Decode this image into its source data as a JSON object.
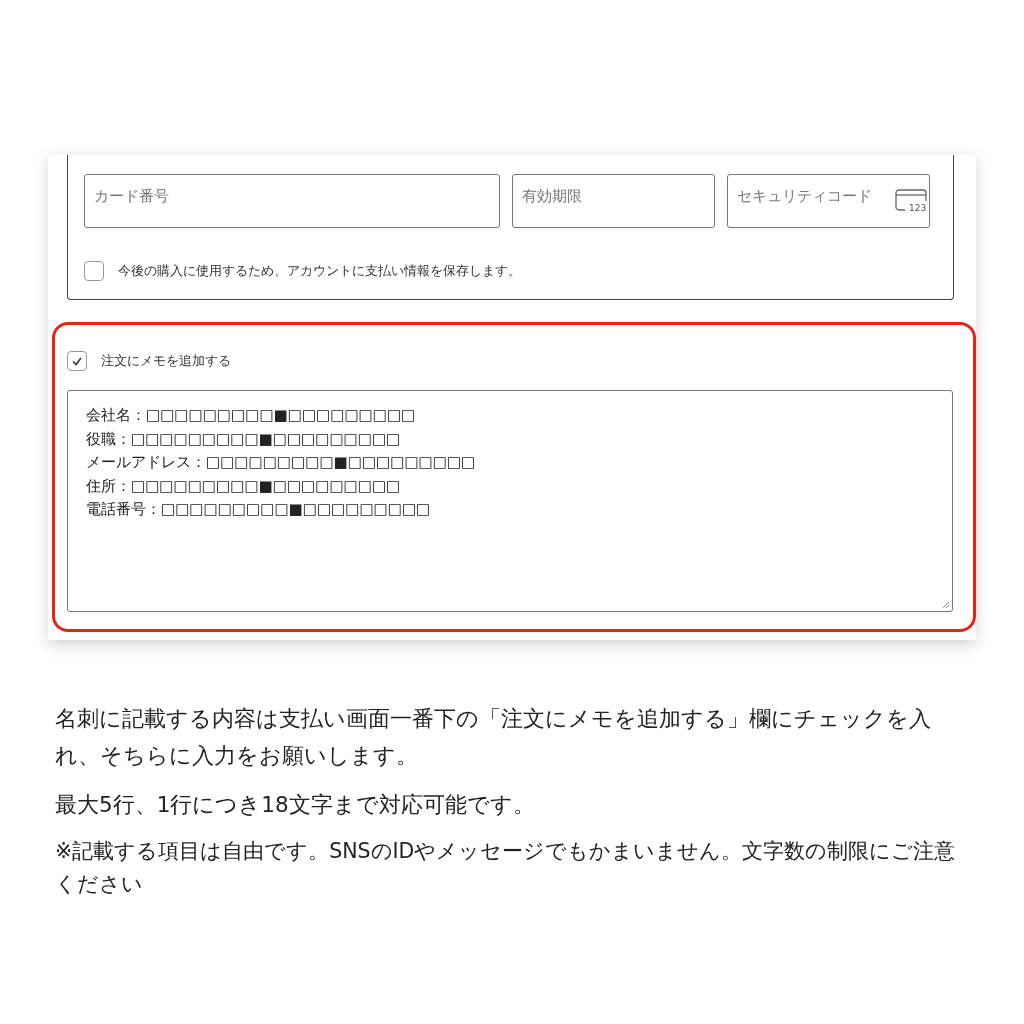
{
  "payment": {
    "fields": [
      {
        "placeholder": "カード番号"
      },
      {
        "placeholder": "有効期限"
      },
      {
        "placeholder": "セキュリティコード",
        "icon_text": "123"
      }
    ],
    "save_info": {
      "label": "今後の購入に使用するため、アカウントに支払い情報を保存します。",
      "checked": false
    }
  },
  "order_note": {
    "label": "注文にメモを追加する",
    "checked": true,
    "highlighted": true,
    "lines": [
      "会社名：□□□□□□□□□■□□□□□□□□□",
      "役職：□□□□□□□□□■□□□□□□□□□",
      "メールアドレス：□□□□□□□□□■□□□□□□□□□",
      "住所：□□□□□□□□□■□□□□□□□□□",
      "電話番号：□□□□□□□□□■□□□□□□□□□"
    ]
  },
  "description": [
    "名刺に記載する内容は支払い画面一番下の「注文にメモを追加する」欄にチェックを入れ、そちらに入力をお願いします。",
    "最大5行、1行につき18文字まで対応可能です。",
    "※記載する項目は自由です。SNSのIDやメッセージでもかまいません。文字数の制限にご注意ください"
  ]
}
